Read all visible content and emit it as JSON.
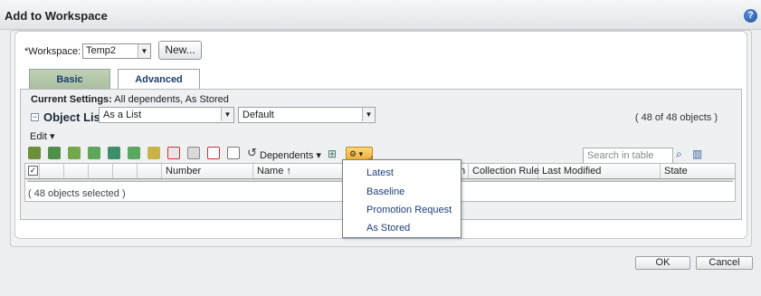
{
  "dialog": {
    "title": "Add to Workspace"
  },
  "workspace": {
    "label": "*Workspace:",
    "selected": "Temp2",
    "new_button": "New..."
  },
  "tabs": [
    {
      "label": "Basic",
      "active": false
    },
    {
      "label": "Advanced",
      "active": true
    }
  ],
  "current_settings": {
    "label": "Current Settings:",
    "value": "All dependents, As Stored"
  },
  "object_list": {
    "title": "Object List",
    "view_combo": "As a List",
    "filter_combo": "Default",
    "count": "( 48 of 48 objects )"
  },
  "toolbar": {
    "edit_menu": "Edit",
    "dependents_label": "Dependents",
    "search_placeholder": "Search in table"
  },
  "table": {
    "columns": [
      "Number",
      "Name",
      "n",
      "Collection Rule",
      "Last Modified",
      "State"
    ],
    "selected_status": "( 48 objects selected )"
  },
  "collection_dropdown": {
    "items": [
      "Latest",
      "Baseline",
      "Promotion Request",
      "As Stored"
    ]
  },
  "buttons": {
    "ok": "OK",
    "cancel": "Cancel"
  },
  "colors": {
    "accent_blue": "#1e3f7a",
    "active_orange": "#f0a92e",
    "tab_green": "#a9bd9f"
  }
}
